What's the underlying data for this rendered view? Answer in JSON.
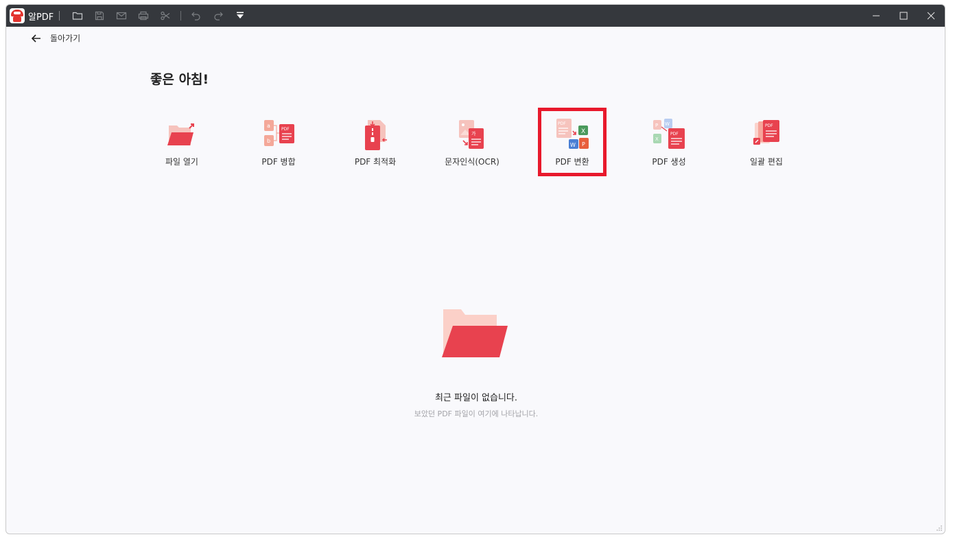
{
  "titlebar": {
    "app_name": "알PDF",
    "toolbar_icons": [
      "folder-icon",
      "save-icon",
      "mail-icon",
      "print-icon",
      "scissors-icon",
      "undo-icon",
      "redo-icon",
      "dropdown-icon"
    ]
  },
  "nav": {
    "back_label": "돌아가기"
  },
  "greeting": "좋은 아침!",
  "tools": [
    {
      "label": "파일 열기",
      "icon": "open-file-icon"
    },
    {
      "label": "PDF 병합",
      "icon": "merge-pdf-icon"
    },
    {
      "label": "PDF 최적화",
      "icon": "optimize-pdf-icon"
    },
    {
      "label": "문자인식(OCR)",
      "icon": "ocr-icon"
    },
    {
      "label": "PDF 변환",
      "icon": "convert-pdf-icon",
      "selected": true
    },
    {
      "label": "PDF 생성",
      "icon": "create-pdf-icon"
    },
    {
      "label": "일괄 편집",
      "icon": "batch-edit-icon"
    }
  ],
  "empty_state": {
    "title": "최근 파일이 없습니다.",
    "subtitle": "보았던 PDF 파일이 여기에 나타납니다."
  },
  "colors": {
    "accent": "#e8424f",
    "selection_outline": "#e8192c",
    "titlebar": "#35383d"
  }
}
